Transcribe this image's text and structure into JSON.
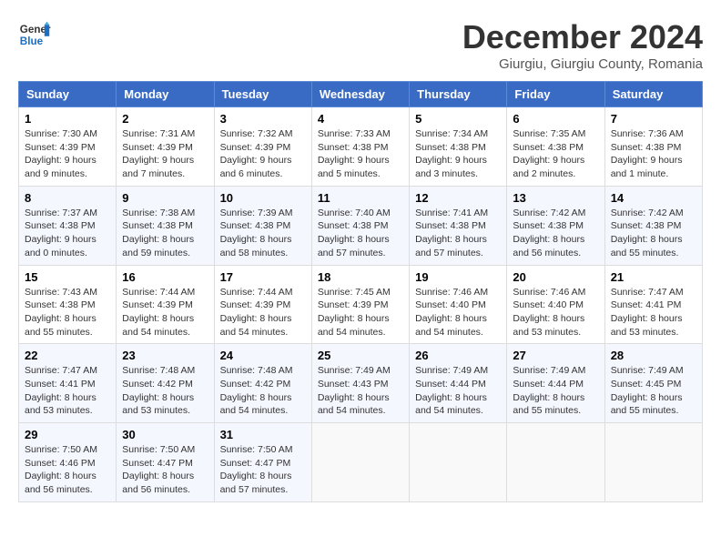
{
  "header": {
    "logo_general": "General",
    "logo_blue": "Blue",
    "month_title": "December 2024",
    "subtitle": "Giurgiu, Giurgiu County, Romania"
  },
  "days_of_week": [
    "Sunday",
    "Monday",
    "Tuesday",
    "Wednesday",
    "Thursday",
    "Friday",
    "Saturday"
  ],
  "weeks": [
    [
      {
        "day": "1",
        "sunrise": "7:30 AM",
        "sunset": "4:39 PM",
        "daylight": "9 hours and 9 minutes."
      },
      {
        "day": "2",
        "sunrise": "7:31 AM",
        "sunset": "4:39 PM",
        "daylight": "9 hours and 7 minutes."
      },
      {
        "day": "3",
        "sunrise": "7:32 AM",
        "sunset": "4:39 PM",
        "daylight": "9 hours and 6 minutes."
      },
      {
        "day": "4",
        "sunrise": "7:33 AM",
        "sunset": "4:38 PM",
        "daylight": "9 hours and 5 minutes."
      },
      {
        "day": "5",
        "sunrise": "7:34 AM",
        "sunset": "4:38 PM",
        "daylight": "9 hours and 3 minutes."
      },
      {
        "day": "6",
        "sunrise": "7:35 AM",
        "sunset": "4:38 PM",
        "daylight": "9 hours and 2 minutes."
      },
      {
        "day": "7",
        "sunrise": "7:36 AM",
        "sunset": "4:38 PM",
        "daylight": "9 hours and 1 minute."
      }
    ],
    [
      {
        "day": "8",
        "sunrise": "7:37 AM",
        "sunset": "4:38 PM",
        "daylight": "9 hours and 0 minutes."
      },
      {
        "day": "9",
        "sunrise": "7:38 AM",
        "sunset": "4:38 PM",
        "daylight": "8 hours and 59 minutes."
      },
      {
        "day": "10",
        "sunrise": "7:39 AM",
        "sunset": "4:38 PM",
        "daylight": "8 hours and 58 minutes."
      },
      {
        "day": "11",
        "sunrise": "7:40 AM",
        "sunset": "4:38 PM",
        "daylight": "8 hours and 57 minutes."
      },
      {
        "day": "12",
        "sunrise": "7:41 AM",
        "sunset": "4:38 PM",
        "daylight": "8 hours and 57 minutes."
      },
      {
        "day": "13",
        "sunrise": "7:42 AM",
        "sunset": "4:38 PM",
        "daylight": "8 hours and 56 minutes."
      },
      {
        "day": "14",
        "sunrise": "7:42 AM",
        "sunset": "4:38 PM",
        "daylight": "8 hours and 55 minutes."
      }
    ],
    [
      {
        "day": "15",
        "sunrise": "7:43 AM",
        "sunset": "4:38 PM",
        "daylight": "8 hours and 55 minutes."
      },
      {
        "day": "16",
        "sunrise": "7:44 AM",
        "sunset": "4:39 PM",
        "daylight": "8 hours and 54 minutes."
      },
      {
        "day": "17",
        "sunrise": "7:44 AM",
        "sunset": "4:39 PM",
        "daylight": "8 hours and 54 minutes."
      },
      {
        "day": "18",
        "sunrise": "7:45 AM",
        "sunset": "4:39 PM",
        "daylight": "8 hours and 54 minutes."
      },
      {
        "day": "19",
        "sunrise": "7:46 AM",
        "sunset": "4:40 PM",
        "daylight": "8 hours and 54 minutes."
      },
      {
        "day": "20",
        "sunrise": "7:46 AM",
        "sunset": "4:40 PM",
        "daylight": "8 hours and 53 minutes."
      },
      {
        "day": "21",
        "sunrise": "7:47 AM",
        "sunset": "4:41 PM",
        "daylight": "8 hours and 53 minutes."
      }
    ],
    [
      {
        "day": "22",
        "sunrise": "7:47 AM",
        "sunset": "4:41 PM",
        "daylight": "8 hours and 53 minutes."
      },
      {
        "day": "23",
        "sunrise": "7:48 AM",
        "sunset": "4:42 PM",
        "daylight": "8 hours and 53 minutes."
      },
      {
        "day": "24",
        "sunrise": "7:48 AM",
        "sunset": "4:42 PM",
        "daylight": "8 hours and 54 minutes."
      },
      {
        "day": "25",
        "sunrise": "7:49 AM",
        "sunset": "4:43 PM",
        "daylight": "8 hours and 54 minutes."
      },
      {
        "day": "26",
        "sunrise": "7:49 AM",
        "sunset": "4:44 PM",
        "daylight": "8 hours and 54 minutes."
      },
      {
        "day": "27",
        "sunrise": "7:49 AM",
        "sunset": "4:44 PM",
        "daylight": "8 hours and 55 minutes."
      },
      {
        "day": "28",
        "sunrise": "7:49 AM",
        "sunset": "4:45 PM",
        "daylight": "8 hours and 55 minutes."
      }
    ],
    [
      {
        "day": "29",
        "sunrise": "7:50 AM",
        "sunset": "4:46 PM",
        "daylight": "8 hours and 56 minutes."
      },
      {
        "day": "30",
        "sunrise": "7:50 AM",
        "sunset": "4:47 PM",
        "daylight": "8 hours and 56 minutes."
      },
      {
        "day": "31",
        "sunrise": "7:50 AM",
        "sunset": "4:47 PM",
        "daylight": "8 hours and 57 minutes."
      },
      null,
      null,
      null,
      null
    ]
  ]
}
